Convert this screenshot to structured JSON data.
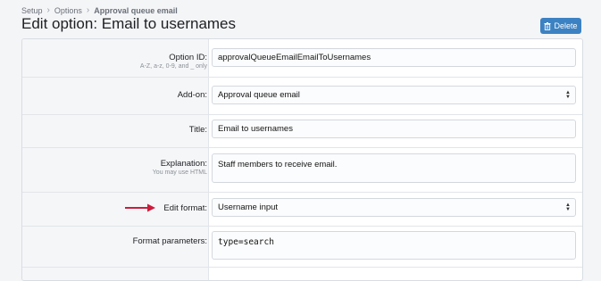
{
  "breadcrumb": {
    "items": [
      "Setup",
      "Options",
      "Approval queue email"
    ]
  },
  "page": {
    "title": "Edit option: Email to usernames",
    "delete_label": "Delete"
  },
  "form": {
    "option_id": {
      "label": "Option ID:",
      "hint": "A-Z, a-z, 0-9, and _ only",
      "value": "approvalQueueEmailEmailToUsernames"
    },
    "addon": {
      "label": "Add-on:",
      "value": "Approval queue email"
    },
    "title": {
      "label": "Title:",
      "value": "Email to usernames"
    },
    "explanation": {
      "label": "Explanation:",
      "hint": "You may use HTML",
      "value": "Staff members to receive email."
    },
    "edit_format": {
      "label": "Edit format:",
      "value": "Username input"
    },
    "format_parameters": {
      "label": "Format parameters:",
      "value": "type=search"
    }
  },
  "colors": {
    "delete_button": "#3c82c3",
    "annotation_arrow": "#cc1c3c"
  },
  "icons": {
    "delete": "trash-icon",
    "select": "select-arrows-icon",
    "annotation": "red-arrow-icon"
  }
}
